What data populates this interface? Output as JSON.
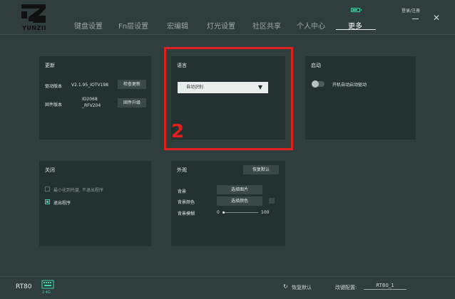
{
  "brand": {
    "logo_text": "YUNZII"
  },
  "nav": {
    "items": [
      {
        "label": "键盘设置"
      },
      {
        "label": "Fn层设置"
      },
      {
        "label": "宏编辑"
      },
      {
        "label": "灯光设置"
      },
      {
        "label": "社区共享"
      },
      {
        "label": "个人中心"
      },
      {
        "label": "更多"
      }
    ],
    "active": "更多"
  },
  "header": {
    "login_label": "登录/注册",
    "battery_icon": "battery-icon",
    "accent_color": "#3fd7b0"
  },
  "update_panel": {
    "title": "更新",
    "driver_label": "驱动版本",
    "driver_version": "V2.1.95_IOTV198",
    "check_update_button": "检查更新",
    "firmware_label": "固件版本",
    "firmware_version_line1": "ID2068",
    "firmware_version_line2": "_RFV204",
    "firmware_upgrade_button": "固件升级"
  },
  "language_panel": {
    "title": "语言",
    "selected": "自动识别",
    "annotation": "2"
  },
  "startup_panel": {
    "title": "启动",
    "autostart_label": "开机自动启动驱动",
    "autostart_enabled": false
  },
  "close_panel": {
    "title": "关闭",
    "option_minimize": "最小化到托盘, 不退出程序",
    "option_minimize_checked": false,
    "option_exit": "退出程序",
    "option_exit_checked": true
  },
  "appearance_panel": {
    "title": "外观",
    "reset_button": "恢复默认",
    "background_label": "背景",
    "choose_image_button": "选择图片",
    "bg_color_label": "背景颜色",
    "choose_color_button": "选择颜色",
    "blur_label": "背景模糊",
    "blur_min": "0",
    "blur_max": "100",
    "blur_value": 0
  },
  "footer": {
    "device_name": "RT80",
    "connection_badge": "2.4G",
    "reset_label": "恢复默认",
    "config_label": "改键配置:",
    "config_value": "RT80_1"
  }
}
